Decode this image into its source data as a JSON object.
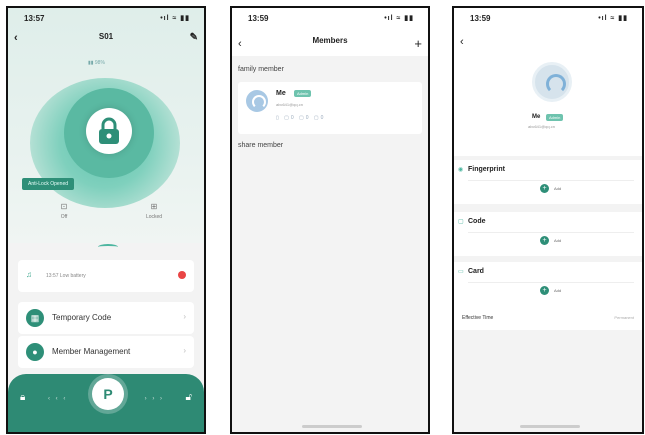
{
  "screen1": {
    "status_time": "13:57",
    "status_icons": "•ıl ≈ ▮▮",
    "title": "S01",
    "battery_mini": "▮▮ 98%",
    "unlock_badge": "Anti-Lock Opened",
    "mode_off": "Off",
    "mode_locked": "Locked",
    "alert_text": "13:57 Low battery",
    "menu_temp": "Temporary Code",
    "menu_member": "Member Management",
    "key_symbol": "P",
    "colors": {
      "accent": "#2e8a74",
      "alert": "#e94545"
    }
  },
  "screen2": {
    "status_time": "13:59",
    "status_icons": "•ıl ≈ ▮▮",
    "title": "Members",
    "family_label": "family member",
    "share_label": "share member",
    "member_name": "Me",
    "member_badge": "Admin",
    "member_email": "abc641@qq.cn",
    "member_icons": "▯ ▢0 ▢0 ▢0"
  },
  "screen3": {
    "status_time": "13:59",
    "status_icons": "•ıl ≈ ▮▮",
    "name": "Me",
    "badge": "Admin",
    "email": "abc641@qq.cn",
    "sections": [
      {
        "title": "Fingerprint",
        "add": "Add"
      },
      {
        "title": "Code",
        "add": "Add"
      },
      {
        "title": "Card",
        "add": "Add"
      }
    ],
    "effective_label": "Effective Time",
    "effective_value": "Permanent"
  }
}
